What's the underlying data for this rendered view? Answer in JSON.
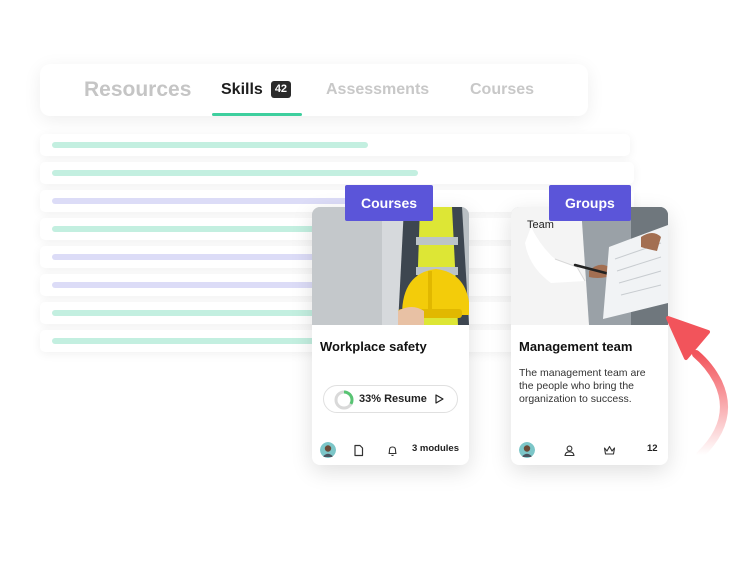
{
  "tabs": {
    "resources": "Resources",
    "skills": "Skills",
    "skills_count": "42",
    "assessments": "Assessments",
    "courses": "Courses"
  },
  "course_card": {
    "tag": "Courses",
    "title": "Workplace safety",
    "progress_percent": 33,
    "resume_label": "33% Resume",
    "modules_label": "3 modules",
    "image": "worker-with-yellow-hard-hat"
  },
  "group_card": {
    "tag": "Groups",
    "image_label": "Team",
    "title": "Management team",
    "description": "The management team are the people who bring the organization to success.",
    "member_count": "12",
    "image": "person-reviewing-documents"
  },
  "icons": {
    "course_footer": [
      "avatar",
      "document-icon",
      "bell-icon"
    ],
    "group_footer": [
      "avatar",
      "user-icon",
      "crown-icon"
    ],
    "resume": "play-icon"
  },
  "colors": {
    "accent_purple": "#5b55d9",
    "accent_green": "#3ecf9e",
    "arrow_red": "#f2545b"
  }
}
